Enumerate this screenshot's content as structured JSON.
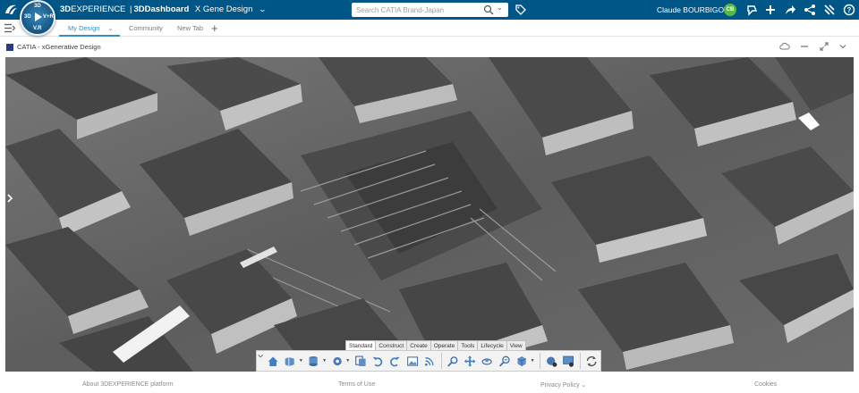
{
  "topbar": {
    "brand_bold": "3D",
    "brand_rest": "EXPERIENCE",
    "brand_separator": "|",
    "app_name": "3DDashboard",
    "dashboard_name": "X Gene Design",
    "search_placeholder": "Search CATIA Brand-Japan",
    "user_name": "Claude BOURBIGOT",
    "user_initials": "CB",
    "compass_quadrants": {
      "top": "3D",
      "left": "3D",
      "right": "V+R",
      "bottom": "V.R"
    },
    "colors": {
      "bar": "#005686",
      "avatar": "#57b847"
    }
  },
  "tabs": [
    {
      "label": "My Design",
      "active": true
    },
    {
      "label": "Community",
      "active": false
    },
    {
      "label": "New Tab",
      "active": false
    }
  ],
  "widget": {
    "title": "CATIA - xGenerative Design",
    "icons": [
      "cloud-icon",
      "minimize-icon",
      "expand-icon",
      "chevron-down-icon"
    ]
  },
  "toolbar": {
    "tabs": [
      {
        "label": "Standard",
        "active": true
      },
      {
        "label": "Construct",
        "active": false
      },
      {
        "label": "Create",
        "active": false
      },
      {
        "label": "Operate",
        "active": false
      },
      {
        "label": "Tools",
        "active": false
      },
      {
        "label": "Lifecycle",
        "active": false
      },
      {
        "label": "View",
        "active": false
      }
    ],
    "icons": [
      "home-icon",
      "open-icon",
      "save-icon",
      "settings-icon",
      "copy-icon",
      "undo-icon",
      "redo-icon",
      "image-icon",
      "feed-icon",
      "zoom-icon",
      "pan-icon",
      "rotate-icon",
      "zoom-area-icon",
      "cube-view-icon",
      "render-icon",
      "capture-icon",
      "sync-icon"
    ]
  },
  "footer": {
    "links": [
      "About 3DEXPERIENCE platform",
      "Terms of Use",
      "Privacy Policy",
      "Cookies"
    ]
  }
}
